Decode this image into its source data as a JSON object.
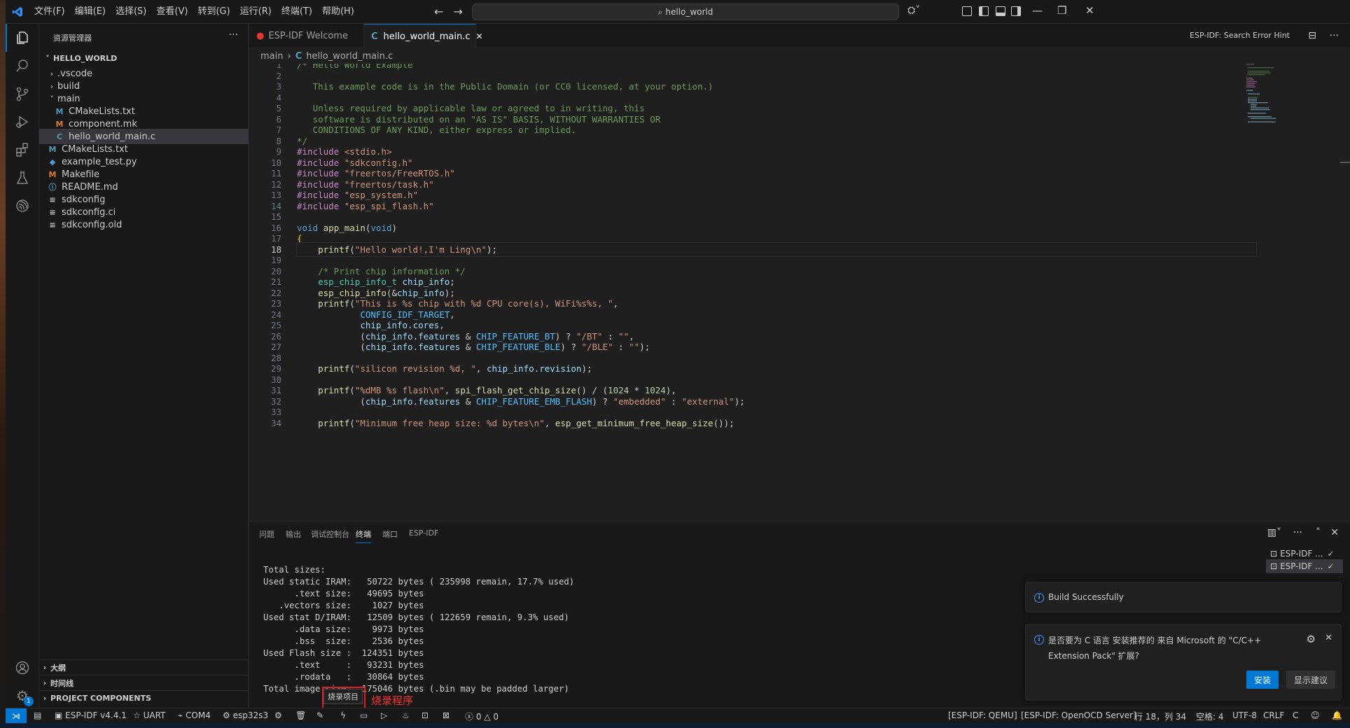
{
  "titlebar": {
    "menus": [
      "文件(F)",
      "编辑(E)",
      "选择(S)",
      "查看(V)",
      "转到(G)",
      "运行(R)",
      "终端(T)",
      "帮助(H)"
    ],
    "search_text": "hello_world"
  },
  "sidebar": {
    "title": "资源管理器",
    "root": "HELLO_WORLD",
    "items": [
      {
        "label": ".vscode",
        "kind": "folder",
        "expanded": false,
        "depth": 1
      },
      {
        "label": "build",
        "kind": "folder",
        "expanded": false,
        "depth": 1
      },
      {
        "label": "main",
        "kind": "folder",
        "expanded": true,
        "depth": 1
      },
      {
        "label": "CMakeLists.txt",
        "kind": "cmake",
        "depth": 2
      },
      {
        "label": "component.mk",
        "kind": "makefile",
        "depth": 2
      },
      {
        "label": "hello_world_main.c",
        "kind": "c",
        "depth": 2,
        "selected": true
      },
      {
        "label": "CMakeLists.txt",
        "kind": "cmake",
        "depth": 1
      },
      {
        "label": "example_test.py",
        "kind": "python",
        "depth": 1
      },
      {
        "label": "Makefile",
        "kind": "makefile",
        "depth": 1
      },
      {
        "label": "README.md",
        "kind": "info",
        "depth": 1
      },
      {
        "label": "sdkconfig",
        "kind": "config",
        "depth": 1
      },
      {
        "label": "sdkconfig.ci",
        "kind": "config",
        "depth": 1
      },
      {
        "label": "sdkconfig.old",
        "kind": "config",
        "depth": 1
      }
    ],
    "sections": [
      "大纲",
      "时间线",
      "PROJECT COMPONENTS"
    ]
  },
  "tabs": [
    {
      "label": "ESP-IDF Welcome",
      "active": false
    },
    {
      "label": "hello_world_main.c",
      "active": true
    }
  ],
  "tab_hint": "ESP-IDF: Search Error Hint",
  "breadcrumb": {
    "folder": "main",
    "file": "hello_world_main.c"
  },
  "editor": {
    "current_line": 18,
    "lines": [
      "/* Hello World Example",
      "",
      "   This example code is in the Public Domain (or CC0 licensed, at your option.)",
      "",
      "   Unless required by applicable law or agreed to in writing, this",
      "   software is distributed on an \"AS IS\" BASIS, WITHOUT WARRANTIES OR",
      "   CONDITIONS OF ANY KIND, either express or implied.",
      "*/",
      "#include <stdio.h>",
      "#include \"sdkconfig.h\"",
      "#include \"freertos/FreeRTOS.h\"",
      "#include \"freertos/task.h\"",
      "#include \"esp_system.h\"",
      "#include \"esp_spi_flash.h\"",
      "",
      "void app_main(void)",
      "{",
      "    printf(\"Hello world!,I'm Ling\\n\");",
      "",
      "    /* Print chip information */",
      "    esp_chip_info_t chip_info;",
      "    esp_chip_info(&chip_info);",
      "    printf(\"This is %s chip with %d CPU core(s), WiFi%s%s, \",",
      "            CONFIG_IDF_TARGET,",
      "            chip_info.cores,",
      "            (chip_info.features & CHIP_FEATURE_BT) ? \"/BT\" : \"\",",
      "            (chip_info.features & CHIP_FEATURE_BLE) ? \"/BLE\" : \"\");",
      "",
      "    printf(\"silicon revision %d, \", chip_info.revision);",
      "",
      "    printf(\"%dMB %s flash\\n\", spi_flash_get_chip_size() / (1024 * 1024),",
      "            (chip_info.features & CHIP_FEATURE_EMB_FLASH) ? \"embedded\" : \"external\");",
      "",
      "    printf(\"Minimum free heap size: %d bytes\\n\", esp_get_minimum_free_heap_size());"
    ]
  },
  "panel": {
    "tabs": [
      "问题",
      "输出",
      "调试控制台",
      "终端",
      "端口",
      "ESP-IDF"
    ],
    "active_tab": "终端",
    "terminal_lines": [
      "Total sizes:",
      "Used static IRAM:   50722 bytes ( 235998 remain, 17.7% used)",
      "      .text size:   49695 bytes",
      "   .vectors size:    1027 bytes",
      "Used stat D/IRAM:   12509 bytes ( 122659 remain, 9.3% used)",
      "      .data size:    9973 bytes",
      "      .bss  size:    2536 bytes",
      "Used Flash size :  124351 bytes",
      "      .text     :   93231 bytes",
      "      .rodata   :   30864 bytes",
      "Total image size:  175046 bytes (.bin may be padded larger)"
    ],
    "terminals": [
      "ESP-IDF ...",
      "ESP-IDF ..."
    ]
  },
  "notifications": {
    "build": "Build Successfully",
    "recommend": "是否要为 C 语言 安装推荐的 来自 Microsoft 的 \"C/C++ Extension Pack\" 扩展?",
    "install_label": "安装",
    "show_label": "显示建议"
  },
  "tooltip": "烧录项目",
  "annotation_label": "烧录程序",
  "statusbar": {
    "idf_version": "ESP-IDF v4.4.1",
    "uart": "UART",
    "port": "COM4",
    "target": "esp32s3",
    "errors": "0",
    "warnings": "0",
    "qemu": "[ESP-IDF: QEMU]",
    "openocd": "[ESP-IDF: OpenOCD Server]",
    "position": "行 18，列 34",
    "spaces": "空格: 4",
    "encoding": "UTF-8",
    "eol": "CRLF",
    "language": "C"
  },
  "colors": {
    "accent": "#0078d4",
    "annotation": "#e02020"
  }
}
